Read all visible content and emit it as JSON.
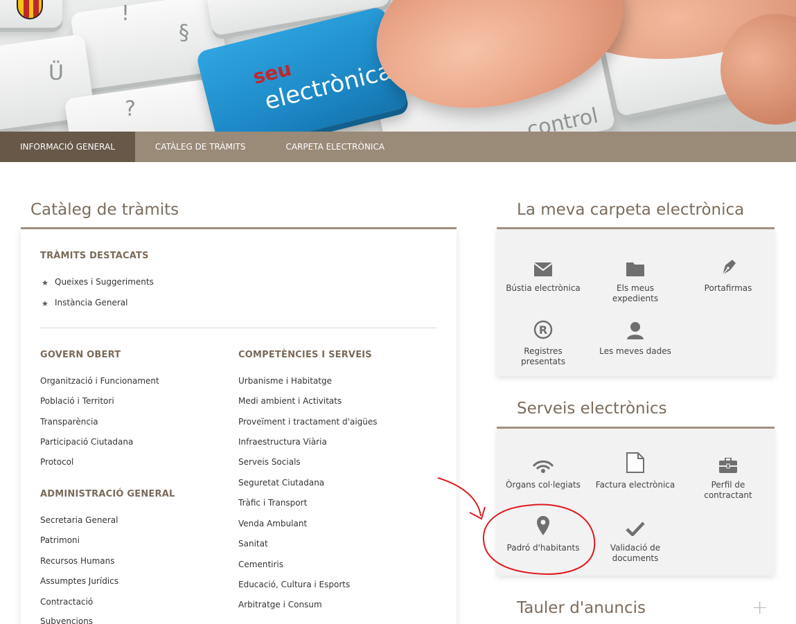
{
  "banner": {
    "seu": "seu",
    "electronica": "electrònica",
    "control": "control"
  },
  "nav": {
    "items": [
      {
        "label": "INFORMACIÓ GENERAL"
      },
      {
        "label": "CATÀLEG DE TRÀMITS"
      },
      {
        "label": "CARPETA ELECTRÒNICA"
      }
    ]
  },
  "catalog": {
    "title": "Catàleg de tràmits",
    "featured": {
      "title": "TRÀMITS DESTACATS",
      "items": [
        "Queixes i Suggeriments",
        "Instància General"
      ]
    },
    "govern": {
      "title": "GOVERN OBERT",
      "items": [
        "Organització i Funcionament",
        "Població i Territori",
        "Transparència",
        "Participació Ciutadana",
        "Protocol"
      ]
    },
    "admin": {
      "title": "ADMINISTRACIÓ GENERAL",
      "items": [
        "Secretaria General",
        "Patrimoni",
        "Recursos Humans",
        "Assumptes Jurídics",
        "Contractació",
        "Subvencions"
      ]
    },
    "competencies": {
      "title": "COMPETÈNCIES I SERVEIS",
      "items": [
        "Urbanisme i Habitatge",
        "Medi ambient i Activitats",
        "Proveïment i tractament d'aigües",
        "Infraestructura Viària",
        "Serveis Socials",
        "Seguretat Ciutadana",
        "Tràfic i Transport",
        "Venda Ambulant",
        "Sanitat",
        "Cementiris",
        "Educació, Cultura i Esports",
        "Arbitratge i Consum"
      ]
    }
  },
  "carpeta": {
    "title": "La meva carpeta electrònica",
    "tiles": [
      {
        "icon": "mail-icon",
        "line1": "Bústia electrònica",
        "line2": ""
      },
      {
        "icon": "folder-icon",
        "line1": "Els meus",
        "line2": "expedients"
      },
      {
        "icon": "pen-nib-icon",
        "line1": "Portafirmas",
        "line2": ""
      },
      {
        "icon": "registered-icon",
        "line1": "Registres",
        "line2": "presentats"
      },
      {
        "icon": "user-icon",
        "line1": "Les meves dades",
        "line2": ""
      }
    ]
  },
  "serveis": {
    "title": "Serveis electrònics",
    "tiles": [
      {
        "icon": "signal-icon",
        "line1": "Òrgans col·legiats",
        "line2": ""
      },
      {
        "icon": "document-icon",
        "line1": "Factura electrònica",
        "line2": ""
      },
      {
        "icon": "briefcase-icon",
        "line1": "Perfil de",
        "line2": "contractant"
      },
      {
        "icon": "map-pin-icon",
        "line1": "Padró d'habitants",
        "line2": ""
      },
      {
        "icon": "check-icon",
        "line1": "Validació de",
        "line2": "documents"
      }
    ]
  },
  "tauler": {
    "title": "Tauler d'anuncis",
    "expand": "+"
  },
  "colors": {
    "nav": "#9a8a78",
    "nav_active": "#675848",
    "accent": "#7c6c5c",
    "annotation": "#e0191e"
  }
}
